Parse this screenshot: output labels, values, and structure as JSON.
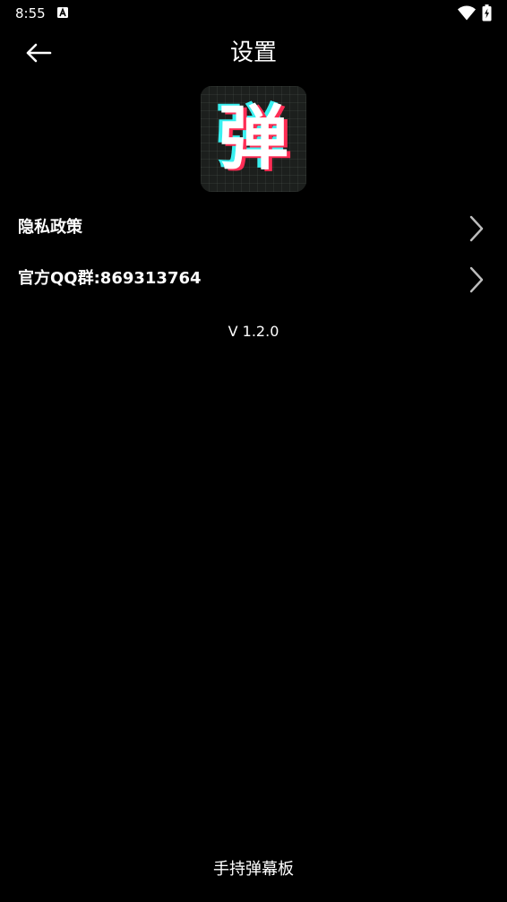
{
  "status_bar": {
    "time": "8:55",
    "icons": [
      "notification-a-icon",
      "wifi-icon",
      "battery-charging-icon"
    ]
  },
  "header": {
    "title": "设置",
    "back_icon": "arrow-left-icon"
  },
  "logo": {
    "glyph": "弹",
    "colors": {
      "cyan": "#39f0f0",
      "red": "#ff2d55",
      "background": "#1c1f1d"
    }
  },
  "menu": {
    "items": [
      {
        "label": "隐私政策",
        "icon": "chevron-right-icon"
      },
      {
        "label": "官方QQ群:869313764",
        "icon": "chevron-right-icon"
      }
    ]
  },
  "version": "V 1.2.0",
  "footer": "手持弹幕板",
  "colors": {
    "background": "#000000",
    "text": "#ffffff",
    "chevron": "#bdbdbd"
  }
}
